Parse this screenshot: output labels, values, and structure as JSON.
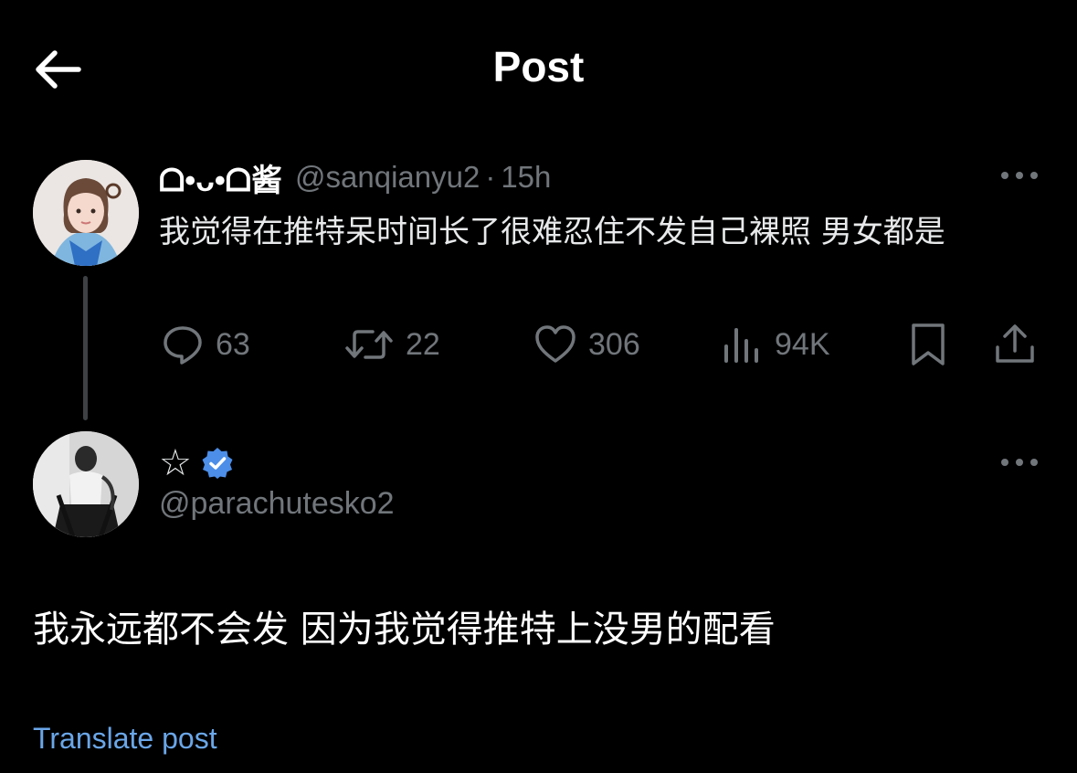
{
  "header": {
    "title": "Post",
    "back_icon": "arrow-left-icon"
  },
  "original_post": {
    "display_name": "ᗝ•ᴗ•ᗝ酱",
    "handle": "@sanqianyu2",
    "separator": "·",
    "time": "15h",
    "text": "我觉得在推特呆时间长了很难忍住不发自己裸照 男女都是",
    "stats": {
      "replies": "63",
      "reposts": "22",
      "likes": "306",
      "views": "94K"
    }
  },
  "reply_post": {
    "display_name": "☆",
    "verified": true,
    "handle": "@parachutesko2",
    "text": "我永远都不会发 因为我觉得推特上没男的配看",
    "translate_label": "Translate post"
  },
  "colors": {
    "background": "#000000",
    "secondary_text": "#71767b",
    "link": "#6aa6e8",
    "verified_badge": "#4c8ee8"
  }
}
